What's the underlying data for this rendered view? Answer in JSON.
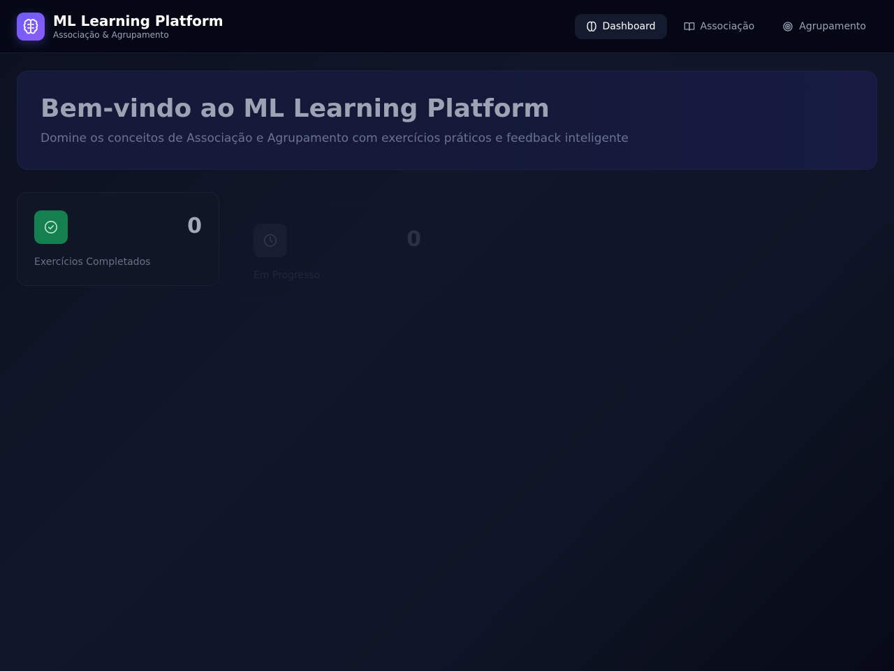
{
  "app": {
    "title": "ML Learning Platform",
    "subtitle": "Associação & Agrupamento",
    "logo_icon": "brain-icon",
    "accent": "#7c5cf6"
  },
  "nav": {
    "items": [
      {
        "label": "Dashboard",
        "icon": "brain-icon",
        "active": true
      },
      {
        "label": "Associação",
        "icon": "book-icon",
        "active": false
      },
      {
        "label": "Agrupamento",
        "icon": "target-icon",
        "active": false
      }
    ]
  },
  "hero": {
    "title": "Bem-vindo ao ML Learning Platform",
    "subtitle": "Domine os conceitos de Associação e Agrupamento com exercícios práticos e feedback inteligente"
  },
  "stats": [
    {
      "label": "Exercícios Completados",
      "value": "0",
      "icon": "check-circle-icon",
      "color": "#15804f"
    },
    {
      "label": "Em Progresso",
      "value": "0",
      "icon": "clock-icon",
      "color": "#3a4464"
    }
  ]
}
